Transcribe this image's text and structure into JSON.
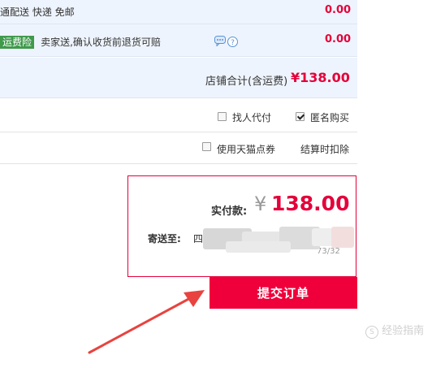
{
  "shipping": {
    "label": "通配送 快递 免邮",
    "fee": "0.00"
  },
  "insurance": {
    "badge": "运费险",
    "desc": "卖家送,确认收货前退货可赔",
    "fee": "0.00"
  },
  "store_total": {
    "label": "店铺合计(含运费)",
    "amount": "¥138.00"
  },
  "options": {
    "pay_by_other": {
      "label": "找人代付",
      "checked": false
    },
    "anonymous": {
      "label": "匿名购买",
      "checked": true
    },
    "tmall_points": {
      "label": "使用天猫点券",
      "checked": false
    },
    "points_note": "结算时扣除"
  },
  "payment": {
    "label": "实付款:",
    "currency": "¥",
    "amount": "138.00",
    "ship_to_label": "寄送至:",
    "address_partial": "四",
    "address_tail": "73/32"
  },
  "submit_button": "提交订单",
  "watermark": "经验指南",
  "colors": {
    "accent": "#e4003a",
    "submit_bg": "#f0003b",
    "badge_bg": "#3f9a4c",
    "panel_bg": "#eef4fd",
    "arrow": "#e8433f"
  }
}
